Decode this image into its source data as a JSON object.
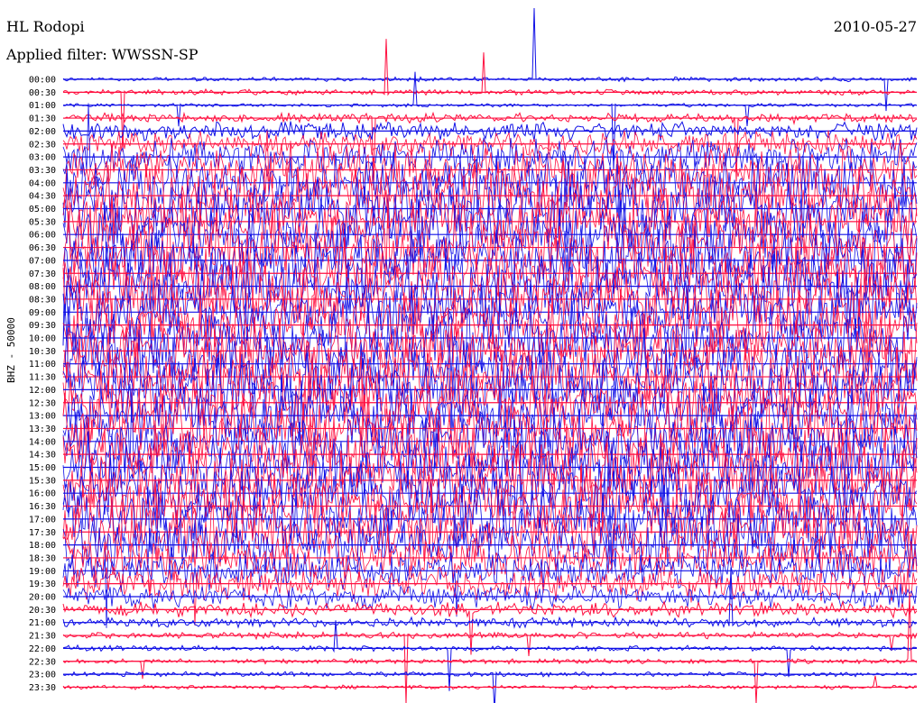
{
  "header": {
    "station": "HL Rodopi",
    "filter_label": "Applied filter: WWSSN-SP",
    "date": "2010-05-27"
  },
  "colors": {
    "trace_a": "#1010e6",
    "trace_b": "#ff1040",
    "background": "#ffffff",
    "text": "#000000"
  },
  "chart_data": {
    "type": "line",
    "title": "HL Rodopi",
    "subtitle": "Applied filter: WWSSN-SP",
    "ylabel": "BHZ - 50000",
    "xlabel": "",
    "grid": false,
    "trace_colors_alternate": [
      "blue",
      "red"
    ],
    "rows": [
      {
        "label": "00:00",
        "color": "blue",
        "activity": 0.04
      },
      {
        "label": "00:30",
        "color": "red",
        "activity": 0.06
      },
      {
        "label": "01:00",
        "color": "blue",
        "activity": 0.03
      },
      {
        "label": "01:30",
        "color": "red",
        "activity": 0.12
      },
      {
        "label": "02:00",
        "color": "blue",
        "activity": 0.25
      },
      {
        "label": "02:30",
        "color": "red",
        "activity": 0.35
      },
      {
        "label": "03:00",
        "color": "blue",
        "activity": 0.55
      },
      {
        "label": "03:30",
        "color": "red",
        "activity": 0.75
      },
      {
        "label": "04:00",
        "color": "blue",
        "activity": 0.9
      },
      {
        "label": "04:30",
        "color": "red",
        "activity": 0.95
      },
      {
        "label": "05:00",
        "color": "blue",
        "activity": 1.0
      },
      {
        "label": "05:30",
        "color": "red",
        "activity": 1.0
      },
      {
        "label": "06:00",
        "color": "blue",
        "activity": 1.0
      },
      {
        "label": "06:30",
        "color": "red",
        "activity": 1.0
      },
      {
        "label": "07:00",
        "color": "blue",
        "activity": 1.0
      },
      {
        "label": "07:30",
        "color": "red",
        "activity": 1.0
      },
      {
        "label": "08:00",
        "color": "blue",
        "activity": 1.0
      },
      {
        "label": "08:30",
        "color": "red",
        "activity": 1.0
      },
      {
        "label": "09:00",
        "color": "blue",
        "activity": 1.0
      },
      {
        "label": "09:30",
        "color": "red",
        "activity": 1.0
      },
      {
        "label": "10:00",
        "color": "blue",
        "activity": 1.0
      },
      {
        "label": "10:30",
        "color": "red",
        "activity": 1.0
      },
      {
        "label": "11:00",
        "color": "blue",
        "activity": 1.0
      },
      {
        "label": "11:30",
        "color": "red",
        "activity": 1.0
      },
      {
        "label": "12:00",
        "color": "blue",
        "activity": 1.0
      },
      {
        "label": "12:30",
        "color": "red",
        "activity": 1.0
      },
      {
        "label": "13:00",
        "color": "blue",
        "activity": 1.0
      },
      {
        "label": "13:30",
        "color": "red",
        "activity": 1.0
      },
      {
        "label": "14:00",
        "color": "blue",
        "activity": 1.0
      },
      {
        "label": "14:30",
        "color": "red",
        "activity": 1.0
      },
      {
        "label": "15:00",
        "color": "blue",
        "activity": 1.0
      },
      {
        "label": "15:30",
        "color": "red",
        "activity": 1.0
      },
      {
        "label": "16:00",
        "color": "blue",
        "activity": 1.0
      },
      {
        "label": "16:30",
        "color": "red",
        "activity": 1.0
      },
      {
        "label": "17:00",
        "color": "blue",
        "activity": 1.0
      },
      {
        "label": "17:30",
        "color": "red",
        "activity": 0.95
      },
      {
        "label": "18:00",
        "color": "blue",
        "activity": 0.9
      },
      {
        "label": "18:30",
        "color": "red",
        "activity": 0.7
      },
      {
        "label": "19:00",
        "color": "blue",
        "activity": 0.55
      },
      {
        "label": "19:30",
        "color": "red",
        "activity": 0.5
      },
      {
        "label": "20:00",
        "color": "blue",
        "activity": 0.35
      },
      {
        "label": "20:30",
        "color": "red",
        "activity": 0.2
      },
      {
        "label": "21:00",
        "color": "blue",
        "activity": 0.12
      },
      {
        "label": "21:30",
        "color": "red",
        "activity": 0.08
      },
      {
        "label": "22:00",
        "color": "blue",
        "activity": 0.06
      },
      {
        "label": "22:30",
        "color": "red",
        "activity": 0.05
      },
      {
        "label": "23:00",
        "color": "blue",
        "activity": 0.05
      },
      {
        "label": "23:30",
        "color": "red",
        "activity": 0.04
      }
    ]
  }
}
